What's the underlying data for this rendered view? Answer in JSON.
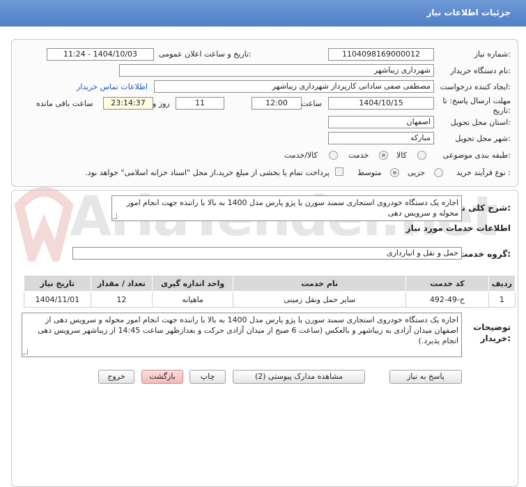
{
  "header": {
    "title": "جزئیات اطلاعات نیاز"
  },
  "form": {
    "need_number_label": "شماره نیاز:",
    "need_number_value": "1104098169000012",
    "announce_label": "تاریخ و ساعت اعلان عمومی:",
    "announce_value": "1404/10/03 - 11:24",
    "buyer_org_label": "نام دستگاه خریدار:",
    "buyer_org_value": "شهرداری زیباشهر",
    "creator_label": "ایجاد کننده درخواست:",
    "creator_value": "مصطفی صفی ساداتی کارپرداز شهرداری زیباشهر",
    "contact_link": "اطلاعات تماس خریدار",
    "deadline_label_1": "مهلت ارسال پاسخ: تا",
    "deadline_label_2": "تاریخ:",
    "deadline_date": "1404/10/15",
    "time_label": "ساعت",
    "deadline_time": "12:00",
    "days_value": "11",
    "days_label": "روز و",
    "remaining_time": "23:14:37",
    "remaining_label": "ساعت باقی مانده",
    "province_label": "استان محل تحویل:",
    "province_value": "اصفهان",
    "city_label": "شهر محل تحویل:",
    "city_value": "مبارکه",
    "category_label": "طبقه بندی موضوعی:",
    "category_options": [
      "کالا",
      "خدمت",
      "کالا/خدمت"
    ],
    "process_label": "نوع فرآیند خرید :",
    "process_options": [
      "جزیی",
      "متوسط"
    ],
    "payment_text": "پرداخت تمام یا بخشی از مبلغ خرید،از محل \"اسناد خزانه اسلامی\" خواهد بود."
  },
  "summary": {
    "label": "شرح کلی نیاز:",
    "text": "اجاره یک دستگاه خودروی استجاری سمند سورن یا پژو پارس مدل 1400 به بالا با راننده جهت انجام امور محوله و سرویس دهی"
  },
  "services": {
    "section_title": "اطلاعات خدمات مورد نیاز",
    "group_label": "گروه خدمت:",
    "group_value": "حمل و نقل و انبارداری",
    "table": {
      "headers": [
        "ردیف",
        "کد خدمت",
        "نام خدمت",
        "واحد اندازه گیری",
        "تعداد / مقدار",
        "تاریخ نیاز"
      ],
      "rows": [
        [
          "1",
          "ح-49-492",
          "سایر حمل ونقل زمینی",
          "ماهیانه",
          "12",
          "1404/11/01"
        ]
      ]
    }
  },
  "buyer_notes": {
    "label_1": "توضیحات",
    "label_2": "خریدار:",
    "text": "اجاره یک دستگاه خودروی استجاری سمند سورن یا پژو پارس مدل 1400 به بالا با راننده جهت انجام امور محوله و سرویس دهی از اصفهان میدان آزادی به زیباشهر و بالعکس (ساعت 6 صبح از میدان آزادی حرکت و بعدازظهر ساعت 14:45 از زیباشهر سرویس دهی انجام پذیرد.)"
  },
  "buttons": {
    "respond": "پاسخ به نیاز",
    "view_docs": "مشاهده مدارک پیوستی (2)",
    "print": "چاپ",
    "back": "بازگشت",
    "exit": "خروج"
  },
  "watermark": {
    "text": "AriaTender.net"
  }
}
